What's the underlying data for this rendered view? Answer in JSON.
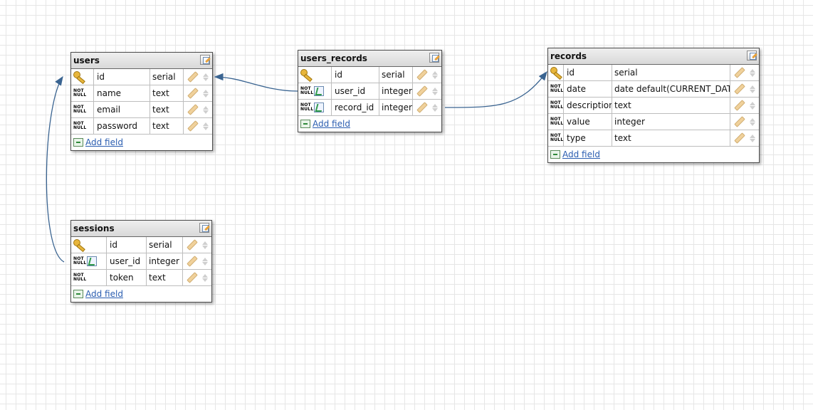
{
  "tables": [
    {
      "id": "users",
      "title": "users",
      "add_field_label": "Add field",
      "fields": [
        {
          "name": "id",
          "type": "serial",
          "pk": true,
          "not_null": false,
          "fk": false
        },
        {
          "name": "name",
          "type": "text",
          "pk": false,
          "not_null": true,
          "fk": false
        },
        {
          "name": "email",
          "type": "text",
          "pk": false,
          "not_null": true,
          "fk": false
        },
        {
          "name": "password",
          "type": "text",
          "pk": false,
          "not_null": true,
          "fk": false
        }
      ]
    },
    {
      "id": "users_records",
      "title": "users_records",
      "add_field_label": "Add field",
      "fields": [
        {
          "name": "id",
          "type": "serial",
          "pk": true,
          "not_null": false,
          "fk": false
        },
        {
          "name": "user_id",
          "type": "integer",
          "pk": false,
          "not_null": true,
          "fk": true
        },
        {
          "name": "record_id",
          "type": "integer",
          "pk": false,
          "not_null": true,
          "fk": true
        }
      ]
    },
    {
      "id": "records",
      "title": "records",
      "add_field_label": "Add field",
      "fields": [
        {
          "name": "id",
          "type": "serial",
          "pk": true,
          "not_null": false,
          "fk": false
        },
        {
          "name": "date",
          "type": "date default(CURRENT_DATE)",
          "pk": false,
          "not_null": true,
          "fk": false
        },
        {
          "name": "description",
          "type": "text",
          "pk": false,
          "not_null": true,
          "fk": false
        },
        {
          "name": "value",
          "type": "integer",
          "pk": false,
          "not_null": true,
          "fk": false
        },
        {
          "name": "type",
          "type": "text",
          "pk": false,
          "not_null": true,
          "fk": false
        }
      ]
    },
    {
      "id": "sessions",
      "title": "sessions",
      "add_field_label": "Add field",
      "fields": [
        {
          "name": "id",
          "type": "serial",
          "pk": true,
          "not_null": false,
          "fk": false
        },
        {
          "name": "user_id",
          "type": "integer",
          "pk": false,
          "not_null": true,
          "fk": true
        },
        {
          "name": "token",
          "type": "text",
          "pk": false,
          "not_null": true,
          "fk": false
        }
      ]
    }
  ],
  "not_null_label": [
    "NOT",
    "NULL"
  ],
  "relations": [
    {
      "from_table": "users_records",
      "from_field": "user_id",
      "to_table": "users",
      "to_field": "id"
    },
    {
      "from_table": "users_records",
      "from_field": "record_id",
      "to_table": "records",
      "to_field": "id"
    },
    {
      "from_table": "sessions",
      "from_field": "user_id",
      "to_table": "users",
      "to_field": "id"
    }
  ],
  "colors": {
    "connector": "#3a6491",
    "grid": "#e6e6e6",
    "link": "#2a5db0"
  }
}
